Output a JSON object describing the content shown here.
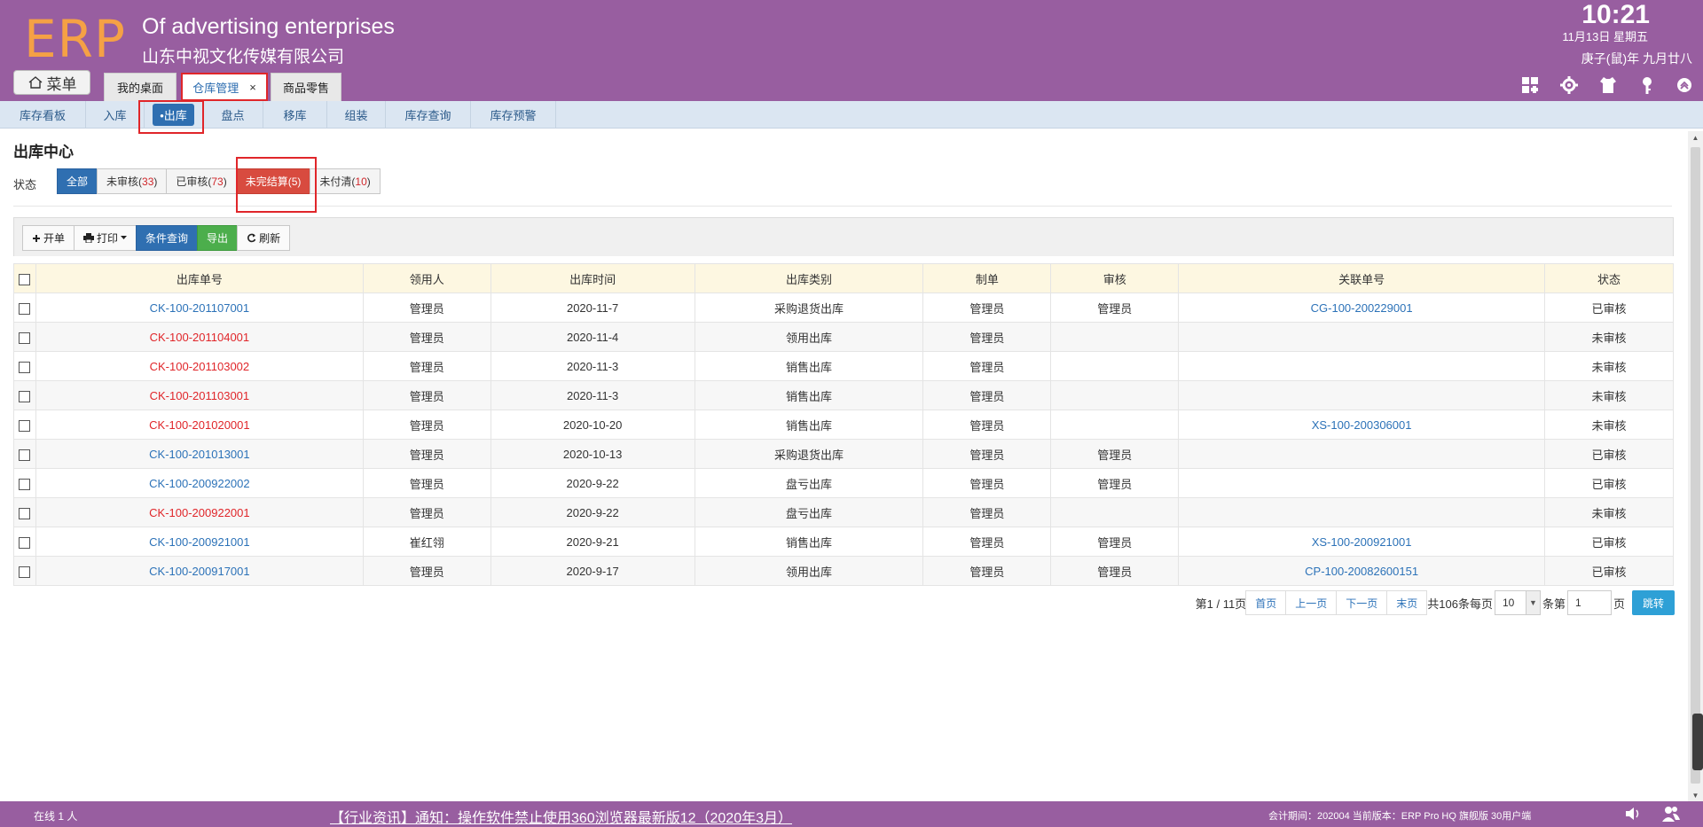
{
  "header": {
    "logo": "ERP",
    "company_en": "Of advertising enterprises",
    "company_cn": "山东中视文化传媒有限公司",
    "time": "10:21",
    "date": "11月13日 星期五",
    "lunar": "庚子(鼠)年 九月廿八",
    "menu_label": "菜单",
    "tabs": [
      {
        "label": "我的桌面"
      },
      {
        "label": "仓库管理",
        "close": "×"
      },
      {
        "label": "商品零售"
      }
    ]
  },
  "subnav": [
    "库存看板",
    "入库",
    "•出库",
    "盘点",
    "移库",
    "组装",
    "库存查询",
    "库存预警"
  ],
  "page": {
    "title": "出库中心",
    "status_label": "状态",
    "status_filters": [
      {
        "label": "全部",
        "count": ""
      },
      {
        "label": "未审核(",
        "count": "33",
        "close": ")"
      },
      {
        "label": "已审核(",
        "count": "73",
        "close": ")"
      },
      {
        "label": "未完结算(",
        "count": "5",
        "close": ")"
      },
      {
        "label": "未付清(",
        "count": "10",
        "close": ")"
      }
    ]
  },
  "toolbar": {
    "new": "开单",
    "print": "打印",
    "query": "条件查询",
    "export": "导出",
    "refresh": "刷新"
  },
  "table": {
    "headers": [
      "出库单号",
      "领用人",
      "出库时间",
      "出库类别",
      "制单",
      "审核",
      "关联单号",
      "状态"
    ],
    "rows": [
      {
        "no": "CK-100-201107001",
        "user": "管理员",
        "date": "2020-11-7",
        "type": "采购退货出库",
        "maker": "管理员",
        "auditor": "管理员",
        "ref": "CG-100-200229001",
        "status": "已审核",
        "red": false
      },
      {
        "no": "CK-100-201104001",
        "user": "管理员",
        "date": "2020-11-4",
        "type": "领用出库",
        "maker": "管理员",
        "auditor": "",
        "ref": "",
        "status": "未审核",
        "red": true
      },
      {
        "no": "CK-100-201103002",
        "user": "管理员",
        "date": "2020-11-3",
        "type": "销售出库",
        "maker": "管理员",
        "auditor": "",
        "ref": "",
        "status": "未审核",
        "red": true
      },
      {
        "no": "CK-100-201103001",
        "user": "管理员",
        "date": "2020-11-3",
        "type": "销售出库",
        "maker": "管理员",
        "auditor": "",
        "ref": "",
        "status": "未审核",
        "red": true
      },
      {
        "no": "CK-100-201020001",
        "user": "管理员",
        "date": "2020-10-20",
        "type": "销售出库",
        "maker": "管理员",
        "auditor": "",
        "ref": "XS-100-200306001",
        "status": "未审核",
        "red": true
      },
      {
        "no": "CK-100-201013001",
        "user": "管理员",
        "date": "2020-10-13",
        "type": "采购退货出库",
        "maker": "管理员",
        "auditor": "管理员",
        "ref": "",
        "status": "已审核",
        "red": false
      },
      {
        "no": "CK-100-200922002",
        "user": "管理员",
        "date": "2020-9-22",
        "type": "盘亏出库",
        "maker": "管理员",
        "auditor": "管理员",
        "ref": "",
        "status": "已审核",
        "red": false
      },
      {
        "no": "CK-100-200922001",
        "user": "管理员",
        "date": "2020-9-22",
        "type": "盘亏出库",
        "maker": "管理员",
        "auditor": "",
        "ref": "",
        "status": "未审核",
        "red": true
      },
      {
        "no": "CK-100-200921001",
        "user": "崔红翎",
        "date": "2020-9-21",
        "type": "销售出库",
        "maker": "管理员",
        "auditor": "管理员",
        "ref": "XS-100-200921001",
        "status": "已审核",
        "red": false
      },
      {
        "no": "CK-100-200917001",
        "user": "管理员",
        "date": "2020-9-17",
        "type": "领用出库",
        "maker": "管理员",
        "auditor": "管理员",
        "ref": "CP-100-20082600151",
        "status": "已审核",
        "red": false
      }
    ]
  },
  "pager": {
    "page_info": "第1 / 11页",
    "first": "首页",
    "prev": "上一页",
    "next": "下一页",
    "last": "末页",
    "total": "共106条每页",
    "per_page": "10",
    "goto_prefix": "条第",
    "goto_value": "1",
    "goto_suffix": "页",
    "go": "跳转"
  },
  "footer": {
    "online": "在线   1   人",
    "notice": "【行业资讯】通知：操作软件禁止使用360浏览器最新版12（2020年3月）",
    "version": "会计期间：202004 当前版本：ERP Pro HQ 旗舰版 30用户端"
  },
  "colors": {
    "brand_purple": "#985ea0",
    "logo_orange": "#f5a145",
    "primary_blue": "#2f6fb1",
    "danger_red": "#e0262a",
    "export_green": "#4cae4c"
  }
}
